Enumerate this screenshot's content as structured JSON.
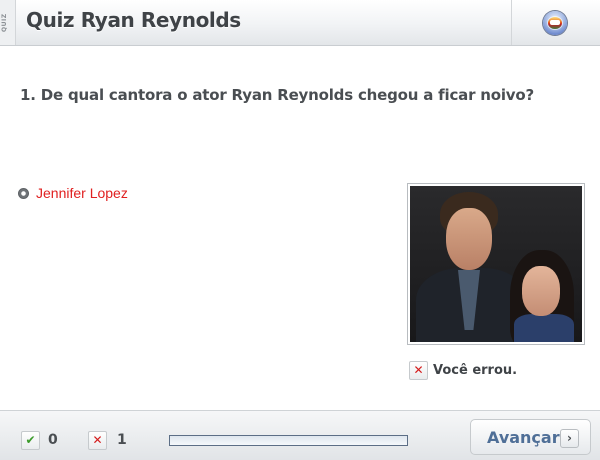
{
  "header": {
    "tag": "QUIZ",
    "title": "Quiz Ryan Reynolds",
    "logo_icon": "globo-globe-icon"
  },
  "question": {
    "text": "1. De qual cantora o ator Ryan Reynolds chegou a ficar noivo?"
  },
  "options": [
    {
      "label": "Jennifer Lopez",
      "state": "selected-wrong",
      "color": "#e02020"
    }
  ],
  "photo": {
    "icon": "photo-image"
  },
  "feedback": {
    "icon": "x-mark-icon",
    "text": "Você errou."
  },
  "footer": {
    "correct_icon": "check-icon",
    "correct_count": "0",
    "wrong_icon": "x-mark-icon",
    "wrong_count": "1",
    "progress_fraction": 0.0,
    "next_label": "Avançar",
    "next_icon": "chevron-right-icon"
  },
  "colors": {
    "accent_blue": "#4f6f97",
    "error_red": "#d41a1a",
    "success_green": "#3a9a2a"
  }
}
